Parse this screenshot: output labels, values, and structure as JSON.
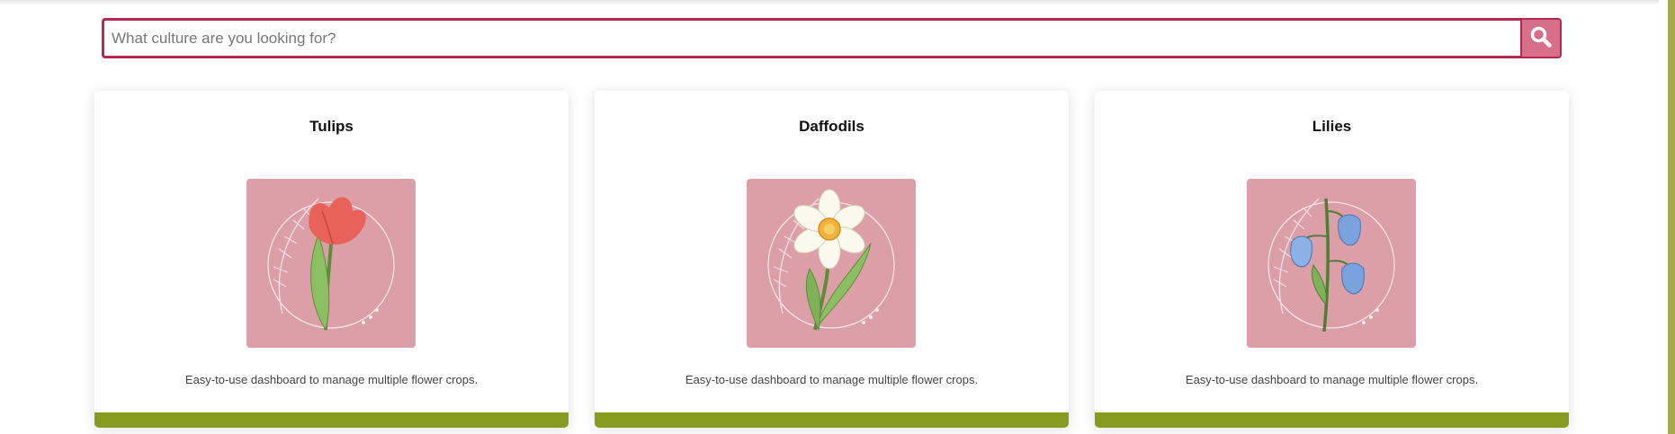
{
  "search": {
    "placeholder": "What culture are you looking for?",
    "button_icon": "search-icon"
  },
  "colors": {
    "accent": "#b5284f",
    "search_button": "#d86f8a",
    "card_image_bg": "#dc9ea7",
    "card_footer": "#869b1f",
    "right_rail": "#a6aa4f"
  },
  "cards": [
    {
      "title": "Tulips",
      "description": "Easy-to-use dashboard to manage multiple flower crops.",
      "image": "tulip-illustration"
    },
    {
      "title": "Daffodils",
      "description": "Easy-to-use dashboard to manage multiple flower crops.",
      "image": "daffodil-illustration"
    },
    {
      "title": "Lilies",
      "description": "Easy-to-use dashboard to manage multiple flower crops.",
      "image": "bluebell-illustration"
    }
  ]
}
